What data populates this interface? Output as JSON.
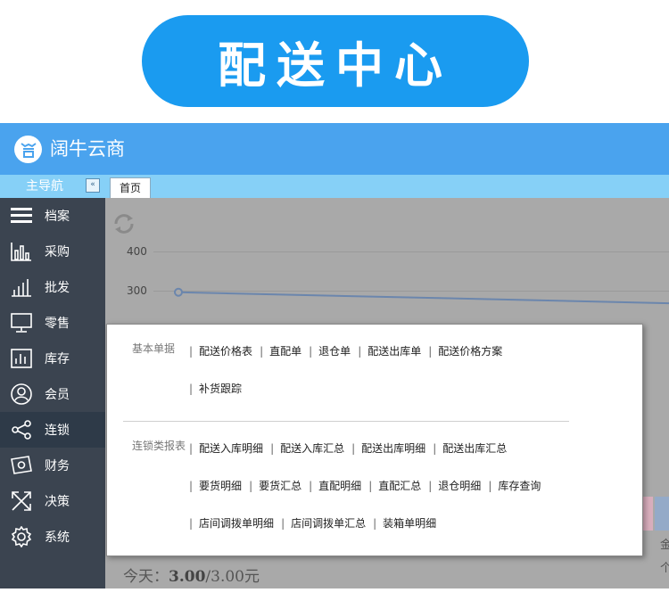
{
  "banner": {
    "title": "配送中心",
    "color": "#1a9bf0"
  },
  "app": {
    "title": "阔牛云商",
    "header_color": "#4aa3ee"
  },
  "tabbar": {
    "nav_title": "主导航",
    "collapse_glyph": "«",
    "tabs": [
      {
        "label": "首页"
      }
    ]
  },
  "sidebar": {
    "items": [
      {
        "label": "档案",
        "icon": "archive-icon"
      },
      {
        "label": "采购",
        "icon": "bar-chart-icon"
      },
      {
        "label": "批发",
        "icon": "wholesale-chart-icon"
      },
      {
        "label": "零售",
        "icon": "monitor-icon"
      },
      {
        "label": "库存",
        "icon": "inventory-icon"
      },
      {
        "label": "会员",
        "icon": "user-icon"
      },
      {
        "label": "连锁",
        "icon": "share-icon",
        "active": true
      },
      {
        "label": "财务",
        "icon": "money-icon"
      },
      {
        "label": "决策",
        "icon": "shuffle-icon"
      },
      {
        "label": "系统",
        "icon": "gear-icon"
      }
    ]
  },
  "content": {
    "y_ticks": [
      "400",
      "300"
    ],
    "today_label": "今天：",
    "today_value": "3.00",
    "today_rest": "/3.00元",
    "edge_chars": [
      "金",
      "个"
    ]
  },
  "chart_data": {
    "type": "line",
    "ylim": [
      250,
      420
    ],
    "series": [
      {
        "values": [
          296,
          268
        ]
      }
    ]
  },
  "popup": {
    "sections": [
      {
        "label": "基本单据",
        "rows": [
          [
            "配送价格表",
            "直配单",
            "退仓单",
            "配送出库单",
            "配送价格方案"
          ],
          [
            "补货跟踪"
          ]
        ]
      },
      {
        "label": "连锁类报表",
        "rows": [
          [
            "配送入库明细",
            "配送入库汇总",
            "配送出库明细",
            "配送出库汇总"
          ],
          [
            "要货明细",
            "要货汇总",
            "直配明细",
            "直配汇总",
            "退仓明细",
            "库存查询"
          ],
          [
            "店间调拨单明细",
            "店间调拨单汇总",
            "装箱单明细"
          ]
        ]
      }
    ]
  }
}
